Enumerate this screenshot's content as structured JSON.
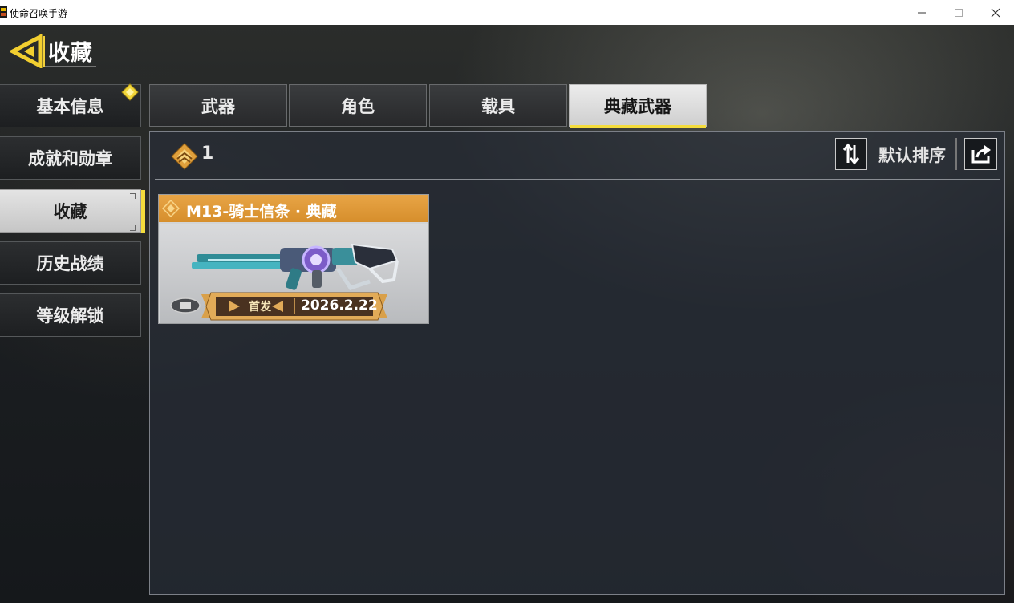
{
  "window": {
    "title": "使命召唤手游",
    "controls": [
      "minimize",
      "maximize",
      "close"
    ]
  },
  "header": {
    "back_icon": "back-arrow-icon",
    "title": "收藏"
  },
  "sidebar": {
    "items": [
      {
        "label": "基本信息",
        "active": false,
        "badge": "diamond-icon"
      },
      {
        "label": "成就和勋章",
        "active": false
      },
      {
        "label": "收藏",
        "active": true
      },
      {
        "label": "历史战绩",
        "active": false
      },
      {
        "label": "等级解锁",
        "active": false
      }
    ]
  },
  "tabs": [
    {
      "label": "武器",
      "active": false
    },
    {
      "label": "角色",
      "active": false
    },
    {
      "label": "载具",
      "active": false
    },
    {
      "label": "典藏武器",
      "active": true
    }
  ],
  "toolbar": {
    "count_icon": "legendary-emblem-icon",
    "count": "1",
    "sort_icon": "sort-arrows-icon",
    "sort_label": "默认排序",
    "share_icon": "share-icon"
  },
  "items": [
    {
      "name": "M13-骑士信条 · 典藏",
      "rarity_color": "#e09a38",
      "badge_label": "首发",
      "date": "2026.2.22"
    }
  ],
  "colors": {
    "accent": "#f4dc3c",
    "legendary": "#e09a38"
  }
}
